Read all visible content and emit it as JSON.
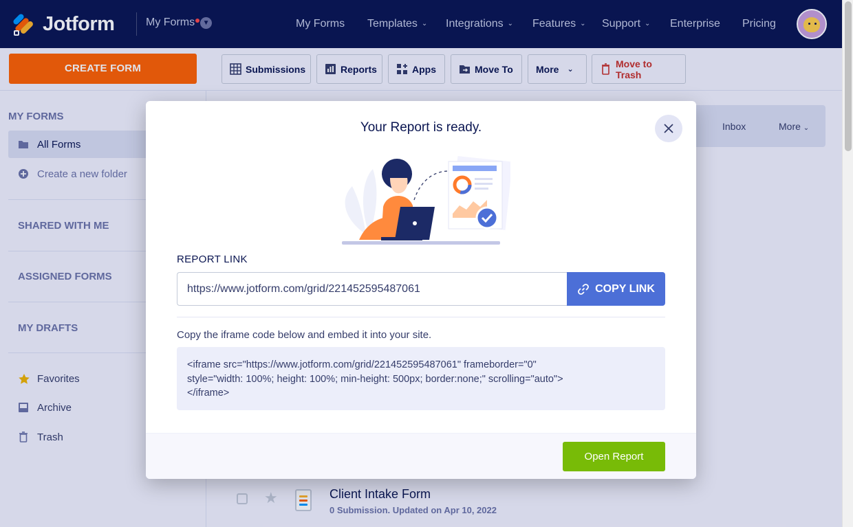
{
  "brand": {
    "logo_text": "Jotform"
  },
  "header": {
    "myforms_dropdown": "My Forms",
    "nav": [
      {
        "label": "My Forms",
        "caret": false
      },
      {
        "label": "Templates",
        "caret": true
      },
      {
        "label": "Integrations",
        "caret": true
      },
      {
        "label": "Features",
        "caret": true
      },
      {
        "label": "Support",
        "caret": true
      },
      {
        "label": "Enterprise",
        "caret": false
      },
      {
        "label": "Pricing",
        "caret": false
      }
    ],
    "avatar_icon": "user-avatar-icon"
  },
  "toolbar": {
    "create_label": "CREATE FORM",
    "buttons": {
      "submissions": "Submissions",
      "reports": "Reports",
      "apps": "Apps",
      "move_to": "Move To",
      "more": "More",
      "trash": "Move to Trash"
    }
  },
  "sidebar": {
    "my_forms_heading": "MY FORMS",
    "all_forms": "All Forms",
    "create_folder": "Create a new folder",
    "shared_with_me": "SHARED WITH ME",
    "assigned_forms": "ASSIGNED FORMS",
    "my_drafts": "MY DRAFTS",
    "favorites": "Favorites",
    "archive": "Archive",
    "trash": "Trash"
  },
  "main": {
    "bar": {
      "inbox": "Inbox",
      "more": "More"
    },
    "form": {
      "title": "Client Intake Form",
      "meta": "0 Submission. Updated on Apr 10, 2022"
    }
  },
  "modal": {
    "title": "Your Report is ready.",
    "report_link_label": "REPORT LINK",
    "report_link_value": "https://www.jotform.com/grid/221452595487061",
    "copy_link_label": "COPY LINK",
    "embed_description": "Copy the iframe code below and embed it into your site.",
    "iframe_code_lines": [
      "<iframe src=\"https://www.jotform.com/grid/221452595487061\" frameborder=\"0\"",
      "style=\"width: 100%; height: 100%; min-height: 500px; border:none;\" scrolling=\"auto\">",
      "</iframe>"
    ],
    "open_report_label": "Open Report"
  },
  "colors": {
    "navbar": "#0a1551",
    "create_button": "#ff6100",
    "copy_button": "#4c6fd7",
    "open_report_button": "#78bb07",
    "trash_red": "#c8302a"
  }
}
